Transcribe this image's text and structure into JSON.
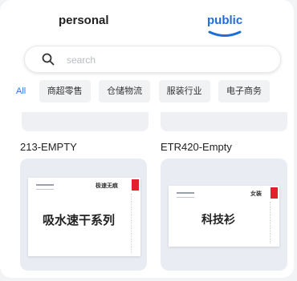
{
  "tabs": [
    {
      "label": "personal",
      "active": false
    },
    {
      "label": "public",
      "active": true
    }
  ],
  "accent_color": "#1e6fd9",
  "search": {
    "placeholder": "search",
    "icon": "search-icon"
  },
  "categories": [
    "All",
    "商超零售",
    "仓储物流",
    "服装行业",
    "电子商务"
  ],
  "active_category": "All",
  "templates": [
    {
      "name": "213-EMPTY",
      "label_tag": "极速无痕",
      "label_text": "吸水速干系列"
    },
    {
      "name": "ETR420-Empty",
      "label_tag": "女装",
      "label_text": "科技衫"
    }
  ]
}
